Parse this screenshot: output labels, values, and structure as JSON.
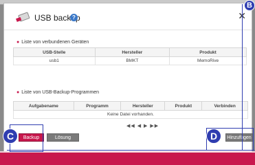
{
  "dialog": {
    "title": "USB backup",
    "help_glyph": "?",
    "close_glyph": "✕"
  },
  "section1": {
    "title": "Liste von verbundenen Geräten",
    "columns": [
      "USB-Stelle",
      "Hersteller",
      "Produkt"
    ],
    "rows": [
      [
        "usb1",
        "BMKT",
        "MemoRive"
      ]
    ]
  },
  "section2": {
    "title": "Liste von USB-Backup-Programmen",
    "columns": [
      "Aufgabename",
      "Programm",
      "Hersteller",
      "Produkt",
      "Verbinden"
    ],
    "empty_text": "Keine Datei vorhanden."
  },
  "pager": {
    "glyphs": "◀◀ ◀ ▶ ▶▶"
  },
  "buttons": {
    "backup": "Backup",
    "loesung": "Lösung",
    "add": "Hinzufügen"
  },
  "markers": {
    "b": "B",
    "c": "C",
    "d": "D"
  },
  "colors": {
    "accent": "#c8184d",
    "marker": "#2f3db0"
  }
}
